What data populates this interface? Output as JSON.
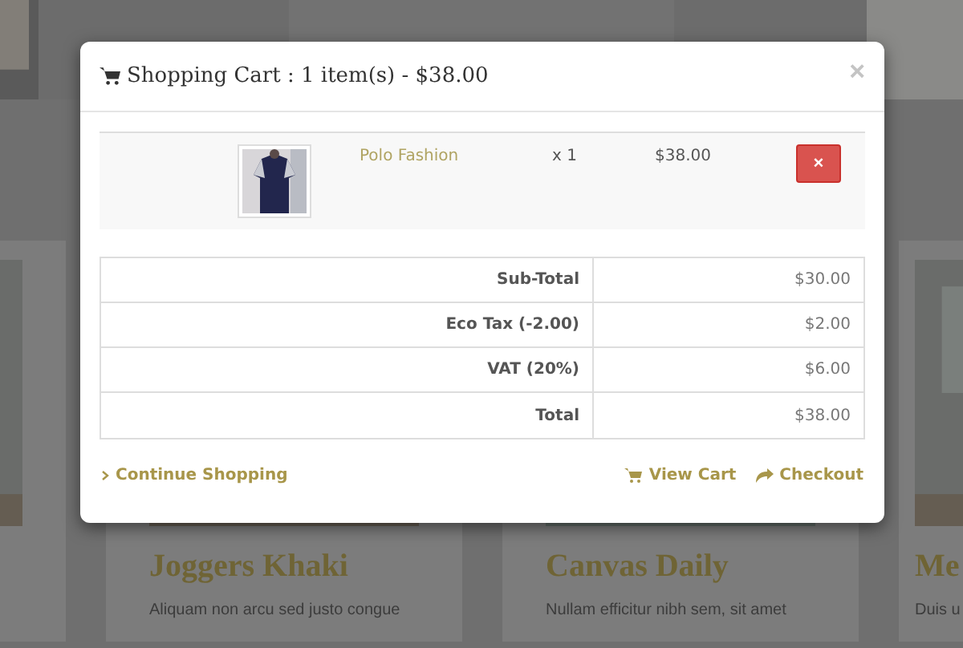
{
  "background": {
    "cards": [
      {
        "title": "Joggers Khaki",
        "text": "Aliquam non arcu sed justo congue"
      },
      {
        "title": "Canvas Daily",
        "text": "Nullam efficitur nibh sem, sit amet"
      },
      {
        "title": "Me",
        "text": "Duis u"
      }
    ]
  },
  "modal": {
    "title": "Shopping Cart : 1 item(s) - $38.00",
    "close": "×",
    "items": [
      {
        "name": "Polo Fashion",
        "quantity": "x 1",
        "price": "$38.00",
        "remove": "×"
      }
    ],
    "totals": [
      {
        "label": "Sub-Total",
        "value": "$30.00"
      },
      {
        "label": "Eco Tax (-2.00)",
        "value": "$2.00"
      },
      {
        "label": "VAT (20%)",
        "value": "$6.00"
      },
      {
        "label": "Total",
        "value": "$38.00"
      }
    ],
    "footer": {
      "left": [
        {
          "label": "Continue Shopping",
          "kind": "continue"
        }
      ],
      "right": [
        {
          "label": "View Cart",
          "kind": "cart"
        },
        {
          "label": "Checkout",
          "kind": "checkout"
        }
      ]
    }
  }
}
